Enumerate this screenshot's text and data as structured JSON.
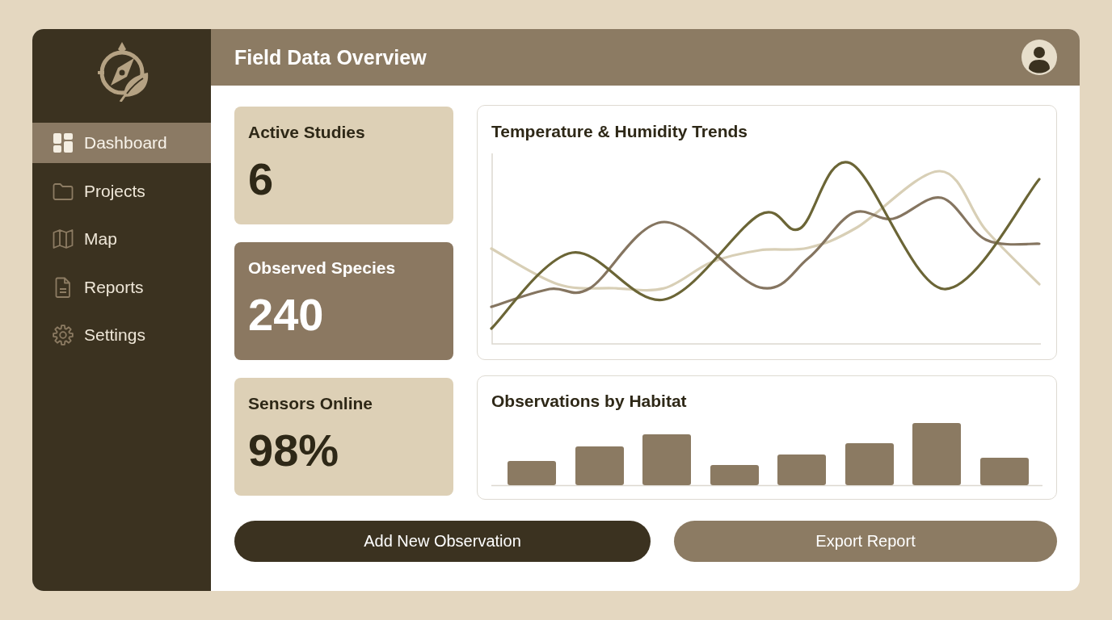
{
  "sidebar": {
    "items": [
      {
        "label": "Dashboard",
        "selected": true
      },
      {
        "label": "Projects",
        "selected": false
      },
      {
        "label": "Map",
        "selected": false
      },
      {
        "label": "Reports",
        "selected": false
      },
      {
        "label": "Settings",
        "selected": false
      }
    ]
  },
  "header": {
    "title": "Field Data Overview"
  },
  "stats": [
    {
      "label": "Active Studies",
      "value": "6",
      "kind": "plain"
    },
    {
      "label": "Observed Species",
      "value": "240",
      "kind": "accent"
    },
    {
      "label": "Sensors Online",
      "value": "98%",
      "kind": "plain"
    }
  ],
  "line_chart": {
    "title": "Temperature & Humidity Trends"
  },
  "bar_chart": {
    "title": "Observations by Habitat"
  },
  "buttons": [
    {
      "label": "Add New Observation",
      "kind": "primary"
    },
    {
      "label": "Export Report",
      "kind": "secondary"
    }
  ]
}
